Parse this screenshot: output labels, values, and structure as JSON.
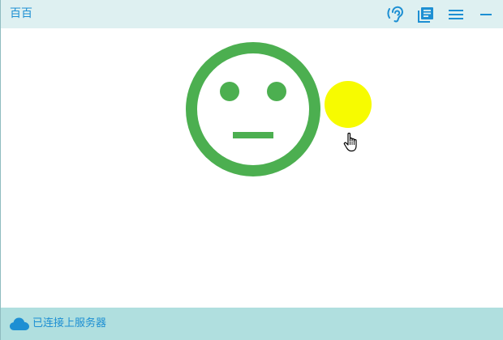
{
  "app": {
    "title": "百百"
  },
  "toolbar": {
    "icons": [
      "ear-icon",
      "notes-icon",
      "menu-icon",
      "minimize-icon"
    ]
  },
  "main": {
    "face_icon": "neutral-face-icon",
    "accent_color": "#4caf50"
  },
  "status": {
    "icon": "cloud-icon",
    "text": "已连接上服务器",
    "color": "#1d8fd3"
  }
}
